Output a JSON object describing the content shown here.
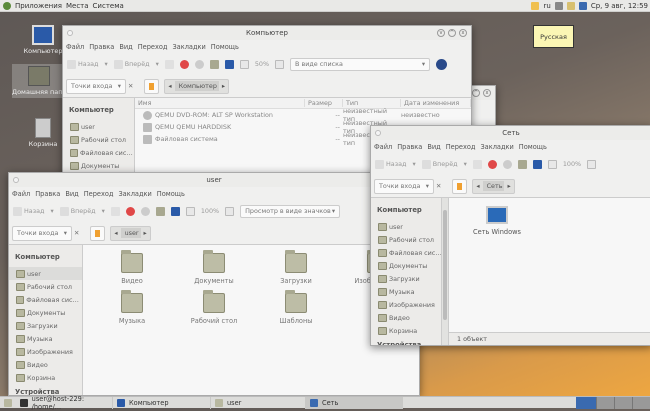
{
  "panel": {
    "menus": [
      "Приложения",
      "Места",
      "Система"
    ],
    "layout": "ru",
    "clock": "Ср, 9 авг, 12:59"
  },
  "tooltip": "Русская",
  "desktop": [
    {
      "label": "Компьютер",
      "icon": "computer-icon"
    },
    {
      "label": "Домашняя папка user",
      "icon": "home-folder-icon"
    },
    {
      "label": "Корзина",
      "icon": "trash-icon"
    }
  ],
  "common": {
    "menu": [
      "Файл",
      "Правка",
      "Вид",
      "Переход",
      "Закладки",
      "Помощь"
    ],
    "back": "Назад",
    "forward": "Вперёд",
    "places": "Точки входа"
  },
  "sidebar": {
    "heading": "Компьютер",
    "items": [
      "user",
      "Рабочий стол",
      "Файловая система",
      "Документы",
      "Загрузки",
      "Музыка",
      "Изображения",
      "Видео",
      "Корзина"
    ],
    "devices": "Устройства"
  },
  "computer_window": {
    "title": "Компьютер",
    "zoom": "50%",
    "view": "В виде списка",
    "location": "Компьютер",
    "columns": [
      "Имя",
      "Размер",
      "Тип",
      "Дата изменения"
    ],
    "rows": [
      {
        "name": "QEMU DVD-ROM: ALT SP Workstation",
        "size": "--",
        "type": "неизвестный тип",
        "date": "неизвестно"
      },
      {
        "name": "QEMU QEMU HARDDISK",
        "size": "--",
        "type": "неизвестный тип",
        "date": "неизвестно"
      },
      {
        "name": "Файловая система",
        "size": "--",
        "type": "неизвестный тип",
        "date": ""
      }
    ]
  },
  "user_window": {
    "title": "user",
    "zoom": "100%",
    "view": "Просмотр в виде значков",
    "location": "user",
    "files": [
      "Видео",
      "Документы",
      "Загрузки",
      "Изображения",
      "Музыка",
      "Рабочий стол",
      "Шаблоны"
    ]
  },
  "network_window": {
    "title": "Сеть",
    "zoom": "100%",
    "location": "Сеть",
    "items": [
      "Сеть Windows"
    ],
    "status": "1 объект"
  },
  "taskbar": [
    "user@host-229: /home/...",
    "Компьютер",
    "user",
    "Сеть"
  ],
  "colors": {
    "stop": "#e04848",
    "folder": "#bdbda6",
    "tooltip": "#fbf6b4"
  }
}
